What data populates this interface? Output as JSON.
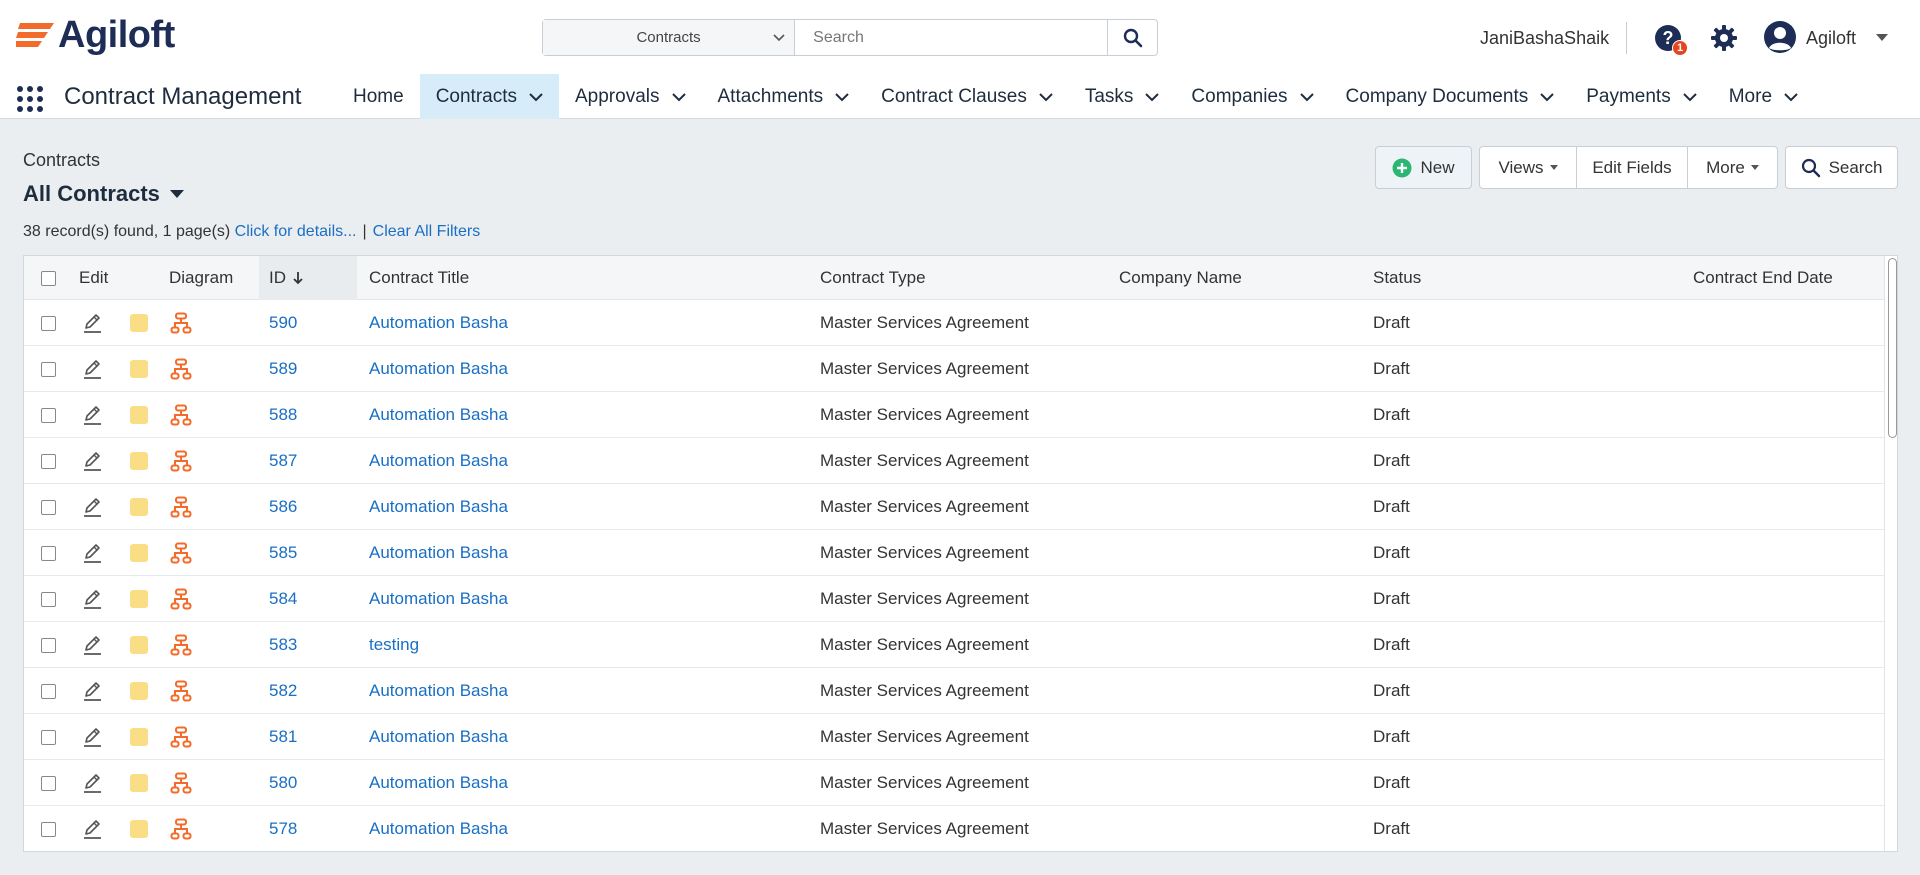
{
  "header": {
    "logo_text": "Agiloft",
    "search_scope": "Contracts",
    "search_placeholder": "Search",
    "username": "JaniBashaShaik",
    "help_badge": "1",
    "account_label": "Agiloft"
  },
  "nav": {
    "app_title": "Contract Management",
    "items": [
      {
        "label": "Home",
        "dropdown": false,
        "active": false
      },
      {
        "label": "Contracts",
        "dropdown": true,
        "active": true
      },
      {
        "label": "Approvals",
        "dropdown": true,
        "active": false
      },
      {
        "label": "Attachments",
        "dropdown": true,
        "active": false
      },
      {
        "label": "Contract Clauses",
        "dropdown": true,
        "active": false
      },
      {
        "label": "Tasks",
        "dropdown": true,
        "active": false
      },
      {
        "label": "Companies",
        "dropdown": true,
        "active": false
      },
      {
        "label": "Company Documents",
        "dropdown": true,
        "active": false
      },
      {
        "label": "Payments",
        "dropdown": true,
        "active": false
      },
      {
        "label": "More",
        "dropdown": true,
        "active": false
      }
    ]
  },
  "page": {
    "breadcrumb": "Contracts",
    "view_title": "All Contracts",
    "records_text": "38 record(s) found, 1 page(s)",
    "details_link": "Click for details...",
    "separator": "|",
    "clear_filters": "Clear All Filters"
  },
  "toolbar": {
    "new_label": "New",
    "views_label": "Views",
    "edit_fields_label": "Edit Fields",
    "more_label": "More",
    "search_label": "Search"
  },
  "table": {
    "columns": {
      "edit": "Edit",
      "diagram": "Diagram",
      "id": "ID",
      "title": "Contract Title",
      "type": "Contract Type",
      "company": "Company Name",
      "status": "Status",
      "end_date": "Contract End Date"
    },
    "rows": [
      {
        "id": "590",
        "title": "Automation Basha",
        "type": "Master Services Agreement",
        "company": "",
        "status": "Draft",
        "end_date": ""
      },
      {
        "id": "589",
        "title": "Automation Basha",
        "type": "Master Services Agreement",
        "company": "",
        "status": "Draft",
        "end_date": ""
      },
      {
        "id": "588",
        "title": "Automation Basha",
        "type": "Master Services Agreement",
        "company": "",
        "status": "Draft",
        "end_date": ""
      },
      {
        "id": "587",
        "title": "Automation Basha",
        "type": "Master Services Agreement",
        "company": "",
        "status": "Draft",
        "end_date": ""
      },
      {
        "id": "586",
        "title": "Automation Basha",
        "type": "Master Services Agreement",
        "company": "",
        "status": "Draft",
        "end_date": ""
      },
      {
        "id": "585",
        "title": "Automation Basha",
        "type": "Master Services Agreement",
        "company": "",
        "status": "Draft",
        "end_date": ""
      },
      {
        "id": "584",
        "title": "Automation Basha",
        "type": "Master Services Agreement",
        "company": "",
        "status": "Draft",
        "end_date": ""
      },
      {
        "id": "583",
        "title": "testing",
        "type": "Master Services Agreement",
        "company": "",
        "status": "Draft",
        "end_date": ""
      },
      {
        "id": "582",
        "title": "Automation Basha",
        "type": "Master Services Agreement",
        "company": "",
        "status": "Draft",
        "end_date": ""
      },
      {
        "id": "581",
        "title": "Automation Basha",
        "type": "Master Services Agreement",
        "company": "",
        "status": "Draft",
        "end_date": ""
      },
      {
        "id": "580",
        "title": "Automation Basha",
        "type": "Master Services Agreement",
        "company": "",
        "status": "Draft",
        "end_date": ""
      },
      {
        "id": "578",
        "title": "Automation Basha",
        "type": "Master Services Agreement",
        "company": "",
        "status": "Draft",
        "end_date": ""
      }
    ]
  },
  "colors": {
    "brand_orange": "#f26b2a",
    "brand_navy": "#1e2d55",
    "link_blue": "#1a6fc4",
    "active_nav": "#d6ecf9",
    "swatch_yellow": "#f9de85",
    "new_plus_green": "#2bb673"
  },
  "icons": {
    "search": "search-icon",
    "help": "question-circle-icon",
    "settings": "gear-icon",
    "account": "user-circle-icon",
    "apps": "apps-grid-icon",
    "edit": "pencil-icon",
    "diagram": "flow-diagram-icon",
    "sort": "sort-down-arrow-icon"
  }
}
